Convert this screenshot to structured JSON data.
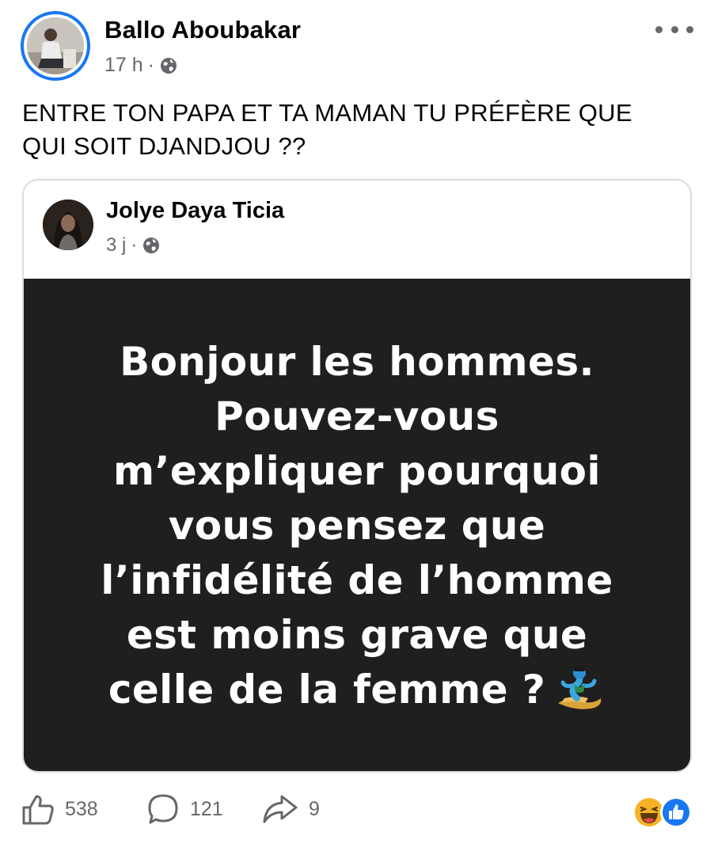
{
  "post": {
    "author": "Ballo Aboubakar",
    "time": "17 h",
    "separator": "·",
    "audience_icon": "globe-icon",
    "text_line1": "ENTRE TON PAPA ET TA MAMAN TU PRÉFÈRE QUE",
    "text_line2": "QUI SOIT DJANDJOU ??"
  },
  "shared": {
    "author": "Jolye Daya Ticia",
    "time": "3 j",
    "separator": "·",
    "audience_icon": "globe-icon",
    "quote_lines": [
      "Bonjour les hommes.",
      "Pouvez-vous",
      "m’expliquer pourquoi",
      "vous pensez que",
      "l’infidélité de l’homme",
      "est moins grave que",
      "celle de la femme ?"
    ],
    "quote_emoji": "genie-emoji",
    "background_color": "#1f1f1f"
  },
  "actions": {
    "likes": "538",
    "comments": "121",
    "shares": "9"
  },
  "reactions": [
    "haha-reaction-icon",
    "like-reaction-icon"
  ],
  "colors": {
    "accent": "#1877f2",
    "secondary_text": "#65676b",
    "haha": "#f7b125"
  }
}
